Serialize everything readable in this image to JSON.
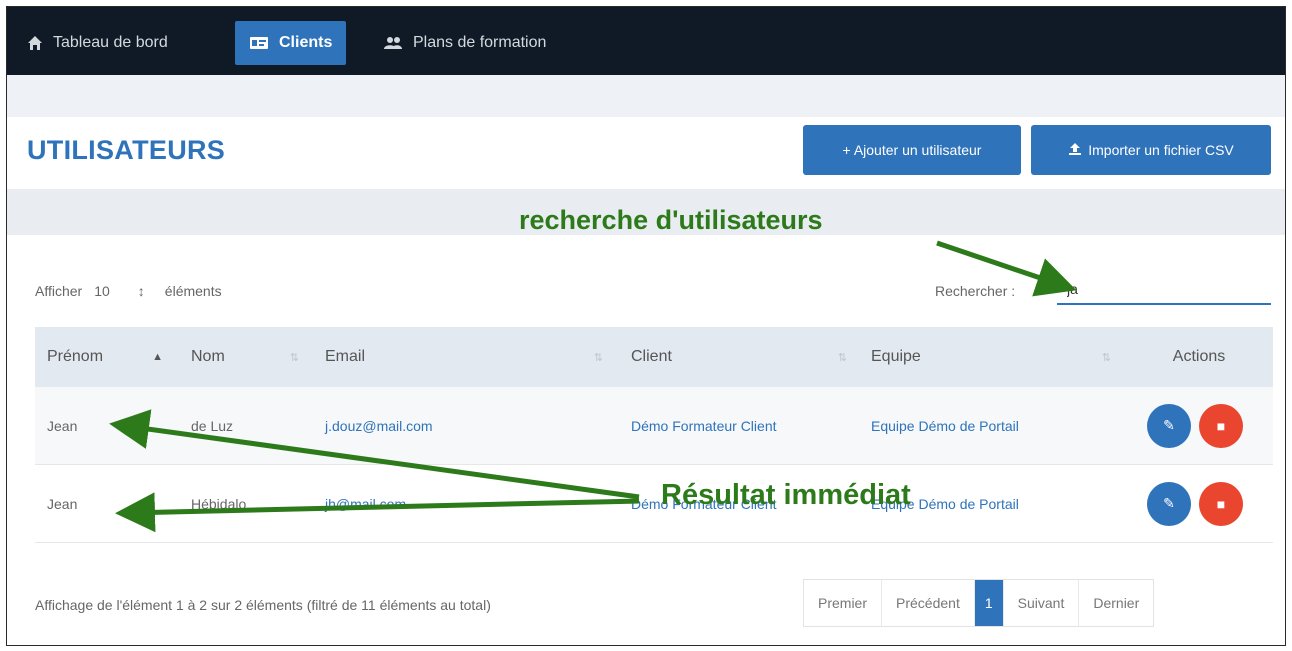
{
  "nav": {
    "items": [
      {
        "label": "Tableau de bord",
        "icon": "home-icon"
      },
      {
        "label": "Clients",
        "icon": "id-card-icon",
        "active": true
      },
      {
        "label": "Plans de formation",
        "icon": "users-icon"
      }
    ]
  },
  "header": {
    "title": "UTILISATEURS",
    "add_button": "+ Ajouter un utilisateur",
    "import_button": "Importer un fichier CSV"
  },
  "controls": {
    "show_prefix": "Afficher",
    "page_size": "10",
    "show_suffix": "éléments",
    "search_label": "Rechercher :",
    "search_value": "ja"
  },
  "table": {
    "columns": [
      "Prénom",
      "Nom",
      "Email",
      "Client",
      "Equipe",
      "Actions"
    ],
    "rows": [
      {
        "prenom": "Jean",
        "nom": "de Luz",
        "email": "j.douz@mail.com",
        "client": "Démo Formateur Client",
        "equipe": "Equipe Démo de Portail"
      },
      {
        "prenom": "Jean",
        "nom": "Hébidalo",
        "email": "jh@mail.com",
        "client": "Démo Formateur Client",
        "equipe": "Equipe Démo de Portail"
      }
    ]
  },
  "footer": {
    "info": "Affichage de l'élément 1 à 2 sur 2 éléments (filtré de 11 éléments au total)",
    "pagination": [
      "Premier",
      "Précédent",
      "1",
      "Suivant",
      "Dernier"
    ]
  },
  "annotations": {
    "search": "recherche d'utilisateurs",
    "result": "Résultat immédiat"
  },
  "colors": {
    "primary": "#2f73ba",
    "danger": "#e9452f",
    "nav_bg": "#0f1a26",
    "annotation": "#2d7a1b"
  }
}
